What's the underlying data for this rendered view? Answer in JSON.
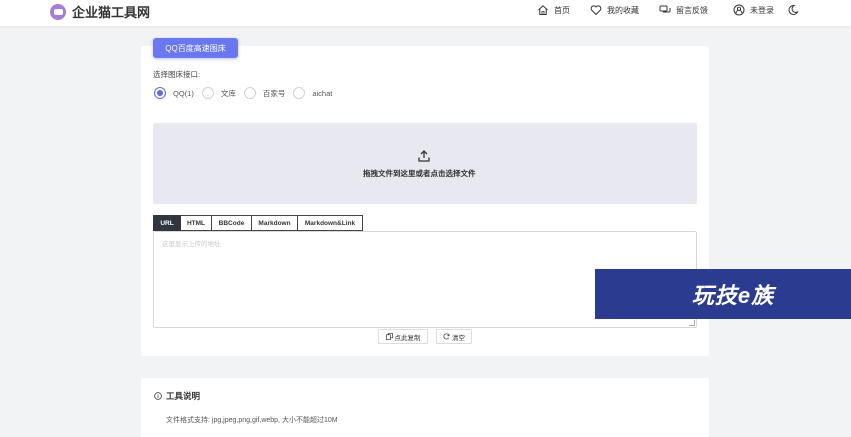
{
  "header": {
    "brand_name": "企业猫工具网",
    "nav": {
      "home": "首页",
      "favorites": "我的收藏",
      "feedback": "留言反馈",
      "login": "未登录"
    }
  },
  "tool": {
    "title": "QQ百度高速图床",
    "select_label": "选择图床接口:",
    "interfaces": [
      "QQ(1)",
      "文库",
      "百家号",
      "aichat"
    ],
    "selected_interface": "QQ(1)",
    "dropzone_text": "拖拽文件到这里或者点击选择文件",
    "tabs": [
      "URL",
      "HTML",
      "BBCode",
      "Markdown",
      "Markdown&Link"
    ],
    "active_tab": "URL",
    "output_placeholder": "这里显示上传的地址",
    "copy_label": "点此复制",
    "clear_label": "清空"
  },
  "info": {
    "title": "工具说明",
    "text": "文件格式支持: jpg,jpeg,png,gif,webp, 大小不能超过10M"
  },
  "watermark": {
    "text": "玩技e族"
  },
  "colors": {
    "accent": "#6a78f0",
    "radio_active": "#5b6ee8",
    "watermark_bg": "#2b3c90"
  }
}
